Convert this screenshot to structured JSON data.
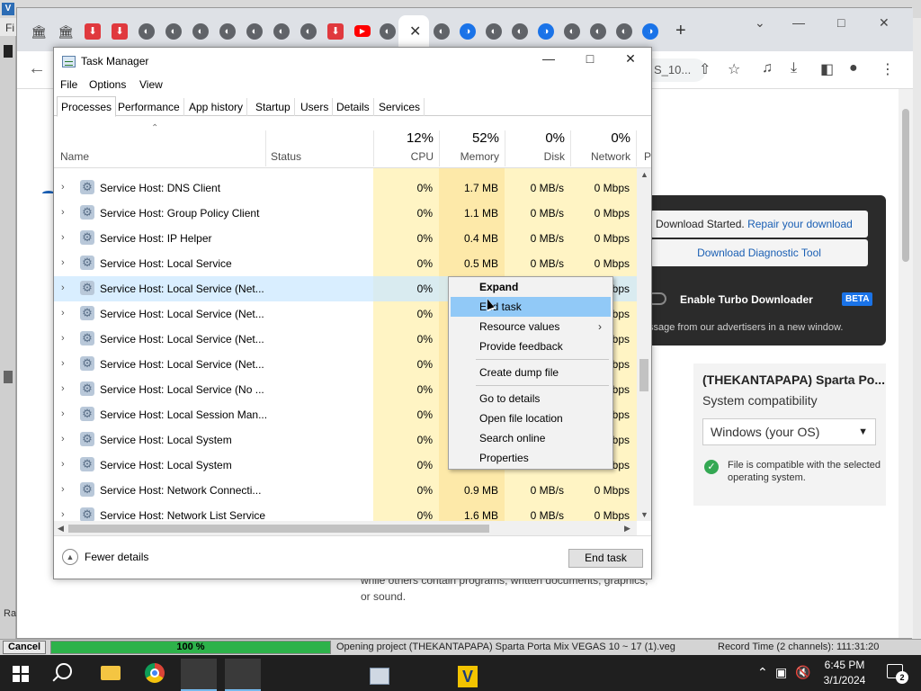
{
  "vegas": {
    "menu_first_letter": "Fi",
    "left_label": "Ra",
    "status": {
      "cancel_label": "Cancel",
      "progress_percent": 100,
      "progress_text": "100 %",
      "message": "Opening project (THEKANTAPAPA) Sparta Porta Mix VEGAS 10 ~ 17 (1).veg",
      "record_time": "Record Time (2 channels): 111:31:20"
    }
  },
  "chrome": {
    "omnibox_tail": "S_10...",
    "content": {
      "download_panel": {
        "started_text": "Download Started.",
        "repair_link": "Repair your download",
        "diagnostic_link": "Download Diagnostic Tool",
        "turbo_label": "Enable Turbo Downloader",
        "beta_badge": "BETA",
        "ad_message": "ssage from our advertisers in a new window."
      },
      "product_card": {
        "title": "(THEKANTAPAPA) Sparta Po...",
        "compat_label": "System compatibility",
        "os_select_value": "Windows (your OS)",
        "compat_message": "File is compatible with the selected operating system."
      },
      "page_text": "while others contain programs, written documents, graphics, or sound."
    }
  },
  "taskmanager": {
    "title": "Task Manager",
    "menu": [
      "File",
      "Options",
      "View"
    ],
    "tabs": [
      "Processes",
      "Performance",
      "App history",
      "Startup",
      "Users",
      "Details",
      "Services"
    ],
    "active_tab": "Processes",
    "columns": {
      "name": "Name",
      "status": "Status",
      "cpu": {
        "pct": "12%",
        "label": "CPU"
      },
      "memory": {
        "pct": "52%",
        "label": "Memory"
      },
      "disk": {
        "pct": "0%",
        "label": "Disk"
      },
      "network": {
        "pct": "0%",
        "label": "Network"
      },
      "partial": "P"
    },
    "rows": [
      {
        "name": "Service Host: DNS Client",
        "cpu": "0%",
        "memory": "1.7 MB",
        "disk": "0 MB/s",
        "network": "0 Mbps"
      },
      {
        "name": "Service Host: Group Policy Client",
        "cpu": "0%",
        "memory": "1.1 MB",
        "disk": "0 MB/s",
        "network": "0 Mbps"
      },
      {
        "name": "Service Host: IP Helper",
        "cpu": "0%",
        "memory": "0.4 MB",
        "disk": "0 MB/s",
        "network": "0 Mbps"
      },
      {
        "name": "Service Host: Local Service",
        "cpu": "0%",
        "memory": "0.5 MB",
        "disk": "0 MB/s",
        "network": "0 Mbps"
      },
      {
        "name": "Service Host: Local Service (Net...",
        "cpu": "0%",
        "memory": "",
        "disk": "",
        "network": "bps"
      },
      {
        "name": "Service Host: Local Service (Net...",
        "cpu": "0%",
        "memory": "",
        "disk": "",
        "network": "bps"
      },
      {
        "name": "Service Host: Local Service (Net...",
        "cpu": "0%",
        "memory": "",
        "disk": "",
        "network": "bps"
      },
      {
        "name": "Service Host: Local Service (Net...",
        "cpu": "0%",
        "memory": "",
        "disk": "",
        "network": "bps"
      },
      {
        "name": "Service Host: Local Service (No ...",
        "cpu": "0%",
        "memory": "",
        "disk": "",
        "network": "bps"
      },
      {
        "name": "Service Host: Local Session Man...",
        "cpu": "0%",
        "memory": "",
        "disk": "",
        "network": "bps"
      },
      {
        "name": "Service Host: Local System",
        "cpu": "0%",
        "memory": "",
        "disk": "",
        "network": "bps"
      },
      {
        "name": "Service Host: Local System",
        "cpu": "0%",
        "memory": "",
        "disk": "",
        "network": "bps"
      },
      {
        "name": "Service Host: Network Connecti...",
        "cpu": "0%",
        "memory": "0.9 MB",
        "disk": "0 MB/s",
        "network": "0 Mbps"
      },
      {
        "name": "Service Host: Network List Service",
        "cpu": "0%",
        "memory": "1.6 MB",
        "disk": "0 MB/s",
        "network": "0 Mbps"
      }
    ],
    "selected_row_index": 4,
    "context_menu": {
      "items": [
        "Expand",
        "End task",
        "Resource values",
        "Provide feedback",
        "Create dump file",
        "Go to details",
        "Open file location",
        "Search online",
        "Properties"
      ],
      "bold_item": "Expand",
      "hover_item": "End task",
      "submenu_item": "Resource values"
    },
    "footer": {
      "fewer_details": "Fewer details",
      "end_task_button": "End task"
    }
  },
  "taskbar": {
    "time": "6:45 PM",
    "date": "3/1/2024",
    "notification_count": "2"
  },
  "colors": {
    "cpu_col_bg": "#fff4c4",
    "memory_col_bg": "#fde9a9",
    "selection": "#cce8ff",
    "menu_hover": "#91c9f7",
    "progress": "#2db24a"
  }
}
